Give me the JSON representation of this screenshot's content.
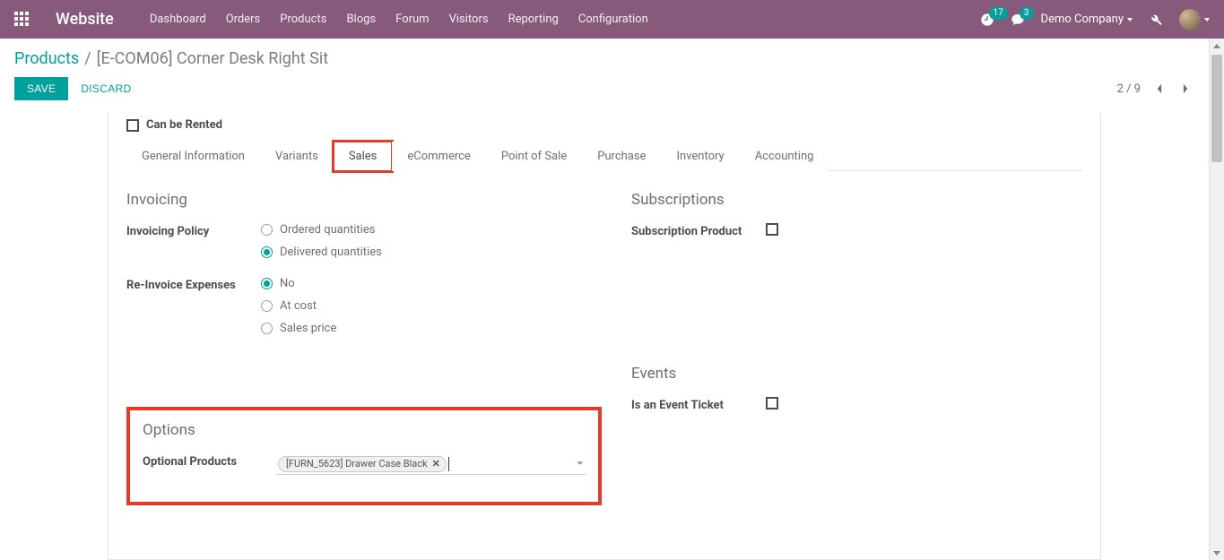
{
  "topbar": {
    "brand": "Website",
    "nav": [
      "Dashboard",
      "Orders",
      "Products",
      "Blogs",
      "Forum",
      "Visitors",
      "Reporting",
      "Configuration"
    ],
    "clock_badge": "17",
    "chat_badge": "3",
    "company": "Demo Company"
  },
  "breadcrumb": {
    "root": "Products",
    "current": "[E-COM06] Corner Desk Right Sit"
  },
  "actions": {
    "save": "SAVE",
    "discard": "DISCARD"
  },
  "pager": {
    "text": "2 / 9"
  },
  "can_be_rented": {
    "label": "Can be Rented",
    "checked": false
  },
  "tabs": [
    "General Information",
    "Variants",
    "Sales",
    "eCommerce",
    "Point of Sale",
    "Purchase",
    "Inventory",
    "Accounting"
  ],
  "active_tab_index": 2,
  "highlight_tab_index": 2,
  "invoicing": {
    "heading": "Invoicing",
    "policy_label": "Invoicing Policy",
    "policy_options": [
      "Ordered quantities",
      "Delivered quantities"
    ],
    "policy_selected": 1,
    "reinvoice_label": "Re-Invoice Expenses",
    "reinvoice_options": [
      "No",
      "At cost",
      "Sales price"
    ],
    "reinvoice_selected": 0
  },
  "subscriptions": {
    "heading": "Subscriptions",
    "sub_label": "Subscription Product",
    "sub_checked": false
  },
  "events": {
    "heading": "Events",
    "ticket_label": "Is an Event Ticket",
    "ticket_checked": false
  },
  "options": {
    "heading": "Options",
    "op_label": "Optional Products",
    "tags": [
      "[FURN_5623] Drawer Case Black"
    ]
  }
}
